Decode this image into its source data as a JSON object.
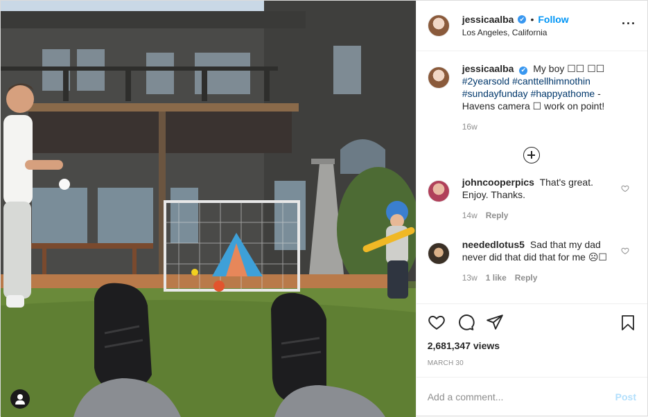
{
  "author": {
    "username": "jessicaalba",
    "verified_glyph": "✔",
    "dot": "•",
    "follow_label": "Follow",
    "location": "Los Angeles, California"
  },
  "caption": {
    "username": "jessicaalba",
    "text_start": "My boy ☐☐ ☐☐",
    "hashtags": [
      "#2yearsold",
      "#canttellhimnothin",
      "#sundayfunday",
      "#happyathome"
    ],
    "text_end": " - Havens camera ☐ work on point!",
    "age": "16w"
  },
  "comments": [
    {
      "username": "johncooperpics",
      "text": "That's great. Enjoy. Thanks.",
      "age": "14w",
      "reply": "Reply"
    },
    {
      "username": "neededlotus5",
      "text": "Sad that my dad never did that did that for me ☹☐",
      "age": "13w",
      "likes": "1 like",
      "reply": "Reply"
    }
  ],
  "stats": {
    "views": "2,681,347 views",
    "date": "MARCH 30"
  },
  "add_comment": {
    "placeholder": "Add a comment...",
    "post_label": "Post"
  },
  "icons": [
    "heart-icon",
    "comment-icon",
    "share-icon",
    "save-icon",
    "more-icon",
    "load-more-icon",
    "tag-user-icon"
  ]
}
